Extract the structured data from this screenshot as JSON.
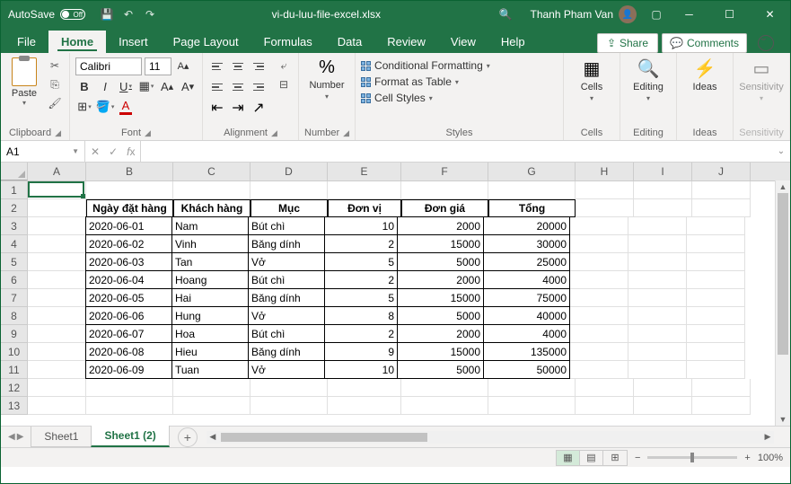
{
  "titlebar": {
    "autosave_label": "AutoSave",
    "autosave_state": "Off",
    "filename": "vi-du-luu-file-excel.xlsx",
    "user_name": "Thanh Pham Van"
  },
  "ribbon": {
    "tabs": [
      "File",
      "Home",
      "Insert",
      "Page Layout",
      "Formulas",
      "Data",
      "Review",
      "View",
      "Help"
    ],
    "active_tab": "Home",
    "share": "Share",
    "comments": "Comments",
    "groups": {
      "clipboard": {
        "label": "Clipboard",
        "paste": "Paste"
      },
      "font": {
        "label": "Font",
        "name": "Calibri",
        "size": "11"
      },
      "alignment": {
        "label": "Alignment"
      },
      "number": {
        "label": "Number",
        "btn": "Number"
      },
      "styles": {
        "label": "Styles",
        "cond": "Conditional Formatting",
        "table": "Format as Table",
        "cell": "Cell Styles"
      },
      "cells": {
        "label": "Cells",
        "btn": "Cells"
      },
      "editing": {
        "label": "Editing",
        "btn": "Editing"
      },
      "ideas": {
        "label": "Ideas",
        "btn": "Ideas"
      },
      "sensitivity": {
        "label": "Sensitivity",
        "btn": "Sensitivity"
      }
    }
  },
  "formula_bar": {
    "name_box": "A1",
    "formula": ""
  },
  "grid": {
    "columns": [
      "A",
      "B",
      "C",
      "D",
      "E",
      "F",
      "G",
      "H",
      "I",
      "J"
    ],
    "row_count": 13,
    "active_cell": "A1",
    "headers": {
      "B": "Ngày đặt hàng",
      "C": "Khách hàng",
      "D": "Mục",
      "E": "Đơn vị",
      "F": "Đơn giá",
      "G": "Tổng"
    },
    "data": [
      {
        "B": "2020-06-01",
        "C": "Nam",
        "D": "Bút chì",
        "E": 10,
        "F": 2000,
        "G": 20000
      },
      {
        "B": "2020-06-02",
        "C": "Vinh",
        "D": "Băng dính",
        "E": 2,
        "F": 15000,
        "G": 30000
      },
      {
        "B": "2020-06-03",
        "C": "Tan",
        "D": "Vở",
        "E": 5,
        "F": 5000,
        "G": 25000
      },
      {
        "B": "2020-06-04",
        "C": "Hoang",
        "D": "Bút chì",
        "E": 2,
        "F": 2000,
        "G": 4000
      },
      {
        "B": "2020-06-05",
        "C": "Hai",
        "D": "Băng dính",
        "E": 5,
        "F": 15000,
        "G": 75000
      },
      {
        "B": "2020-06-06",
        "C": "Hung",
        "D": "Vở",
        "E": 8,
        "F": 5000,
        "G": 40000
      },
      {
        "B": "2020-06-07",
        "C": "Hoa",
        "D": "Bút chì",
        "E": 2,
        "F": 2000,
        "G": 4000
      },
      {
        "B": "2020-06-08",
        "C": "Hieu",
        "D": "Băng dính",
        "E": 9,
        "F": 15000,
        "G": 135000
      },
      {
        "B": "2020-06-09",
        "C": "Tuan",
        "D": "Vở",
        "E": 10,
        "F": 5000,
        "G": 50000
      }
    ]
  },
  "sheets": {
    "tabs": [
      "Sheet1",
      "Sheet1 (2)"
    ],
    "active": "Sheet1 (2)"
  },
  "status": {
    "zoom": "100%"
  }
}
